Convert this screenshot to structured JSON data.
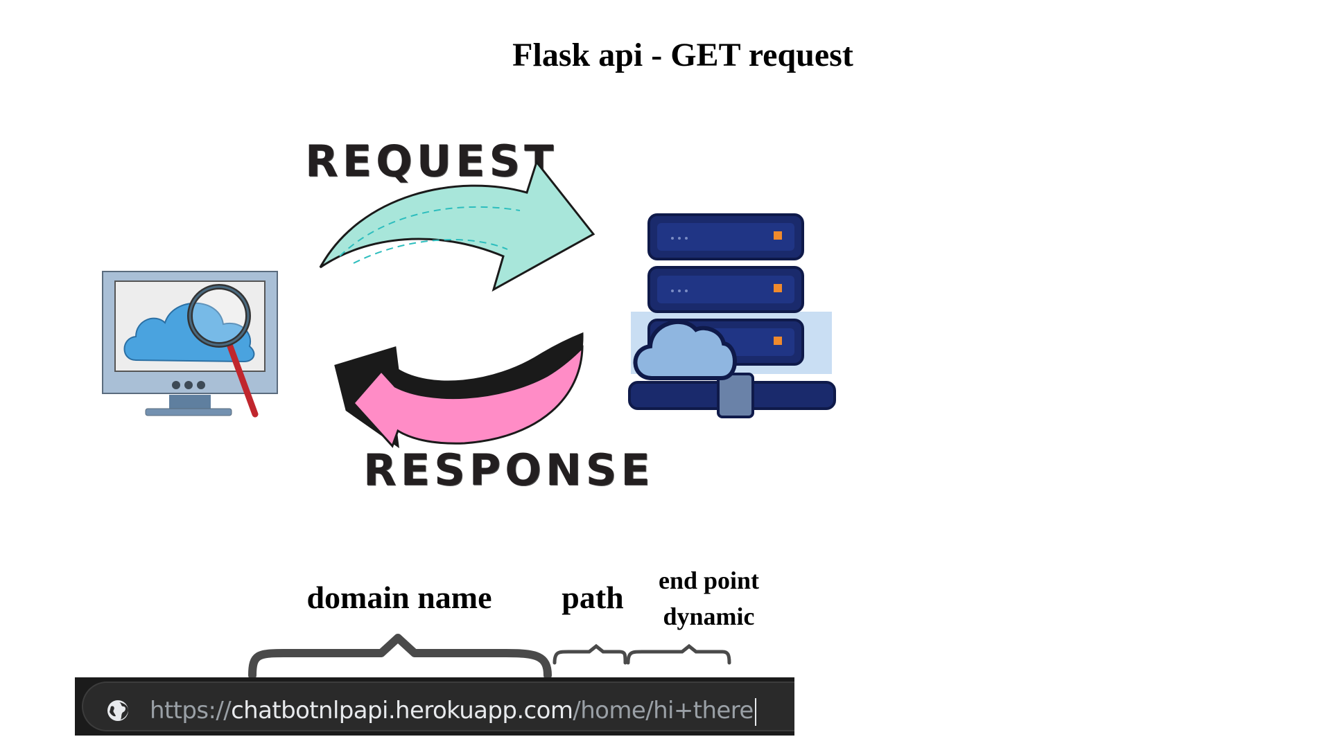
{
  "title": "Flask api - GET request",
  "diagram": {
    "request_label": "REQUEST",
    "response_label": "RESPONSE",
    "client_icon": "computer-cloud-search-icon",
    "server_icon": "server-cloud-icon",
    "request_arrow_icon": "curved-arrow-right-icon",
    "response_arrow_icon": "curved-arrow-left-icon",
    "colors": {
      "request_arrow": "#a8e6da",
      "request_arrow_stripe": "#2cbdbd",
      "response_arrow": "#ff8cc6",
      "response_arrow_shadow": "#1a1a1a",
      "server_blue": "#1a2a6c",
      "cloud_blue": "#4aa3df"
    }
  },
  "url_parts": {
    "domain_label": "domain name",
    "path_label": "path",
    "endpoint_line1": "end point",
    "endpoint_line2": "dynamic"
  },
  "url_bar": {
    "scheme": "https://",
    "domain": "chatbotnlpapi.herokuapp.com",
    "path": "/home/hi+there",
    "icon": "globe-icon"
  }
}
